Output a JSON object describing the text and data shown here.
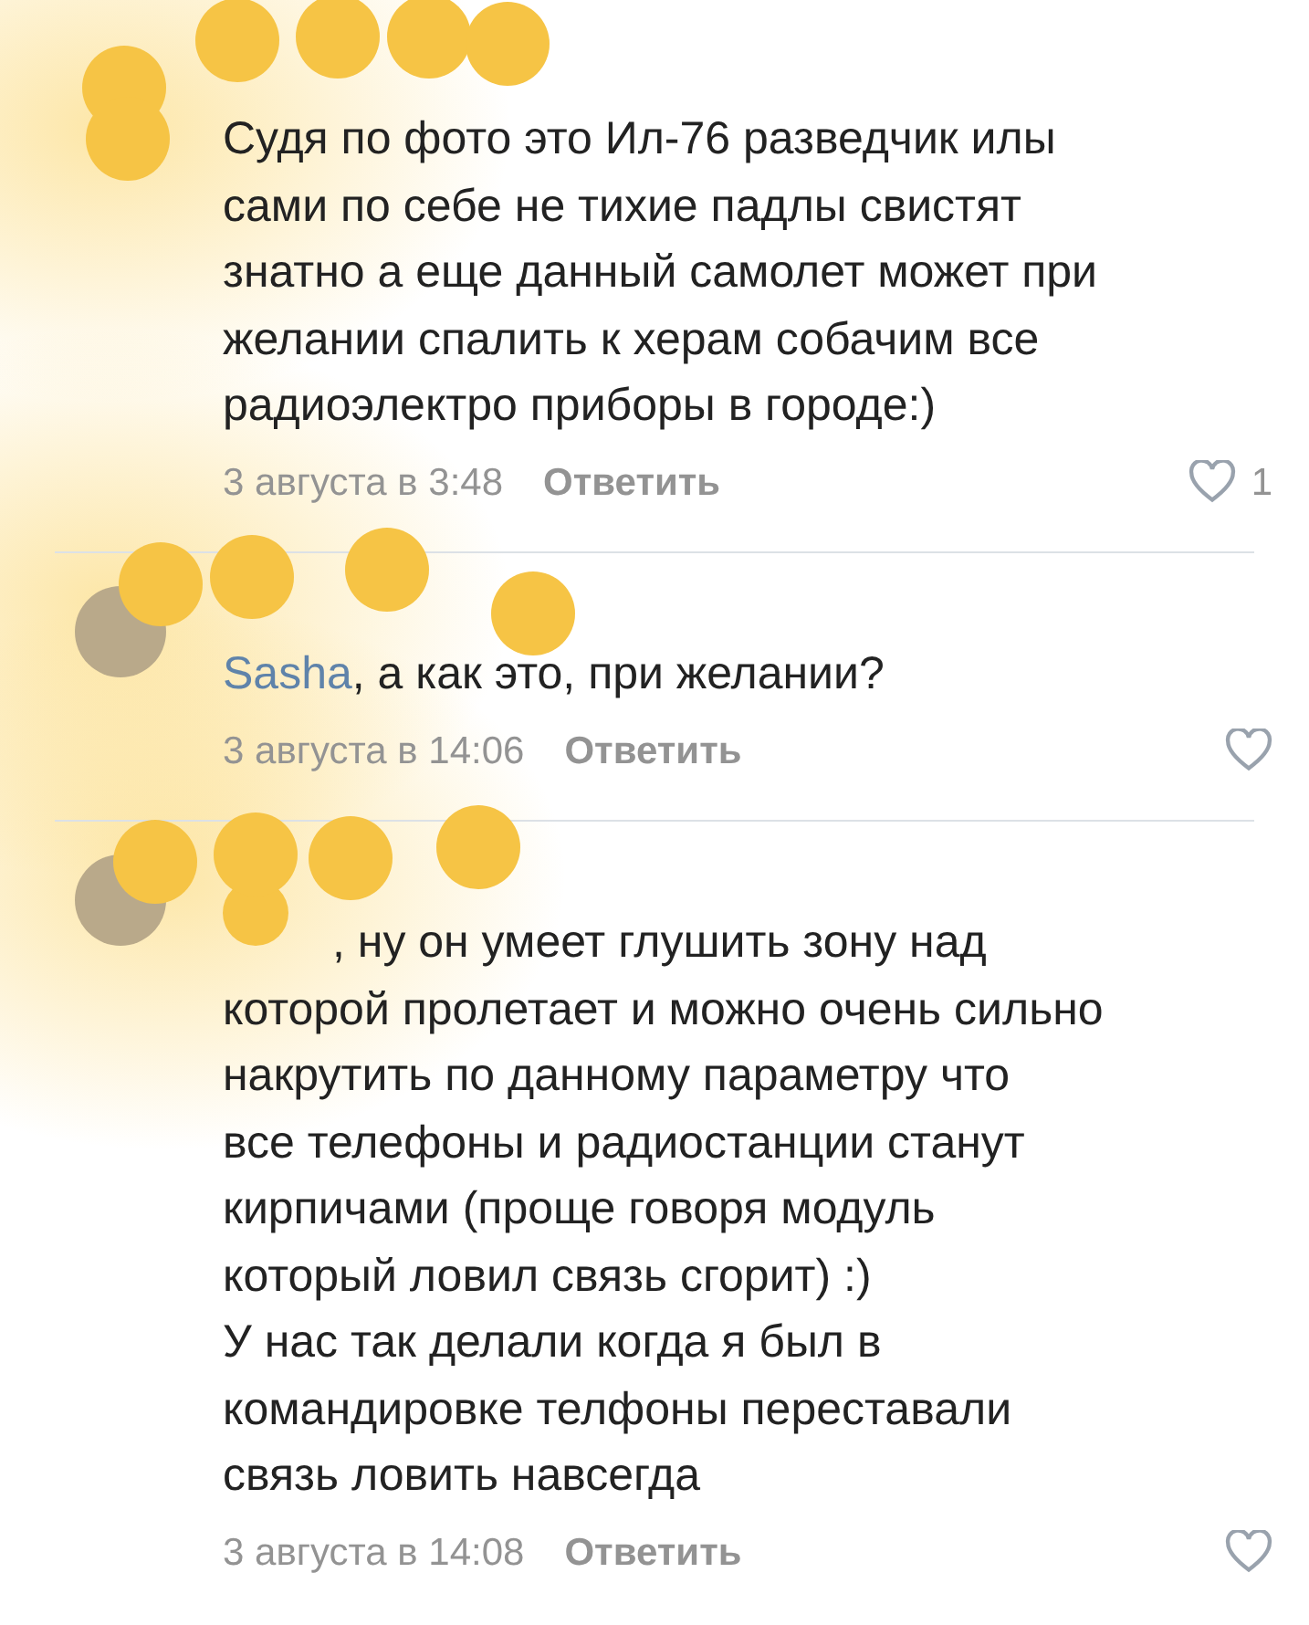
{
  "comments": [
    {
      "lines": [
        "Судя по фото это Ил-76 разведчик илы",
        "сами по себе не тихие падлы свистят",
        "знатно  а еще данный самолет может при",
        "желании спалить к херам собачим все",
        "радиоэлектро приборы в городе:)"
      ],
      "date": "3 августа в 3:48",
      "reply": "Ответить",
      "liked": false,
      "likes": "1"
    },
    {
      "reply_to": "Sasha",
      "lines": [
        ", а как это, при желании?"
      ],
      "date": "3 августа в 14:06",
      "reply": "Ответить",
      "liked": false
    },
    {
      "censored_prefix": true,
      "lines": [
        ", ну он умеет глушить зону над",
        "которой пролетает и можно очень сильно",
        "накрутить по данному параметру что",
        "все телефоны и радиостанции  станут",
        "кирпичами (проще говоря модуль",
        "который ловил связь сгорит) :)",
        "У нас так делали когда я был в",
        "командировке телфоны переставали",
        "связь ловить навсегда"
      ],
      "date": "3 августа в 14:08",
      "reply": "Ответить",
      "liked": false
    }
  ]
}
